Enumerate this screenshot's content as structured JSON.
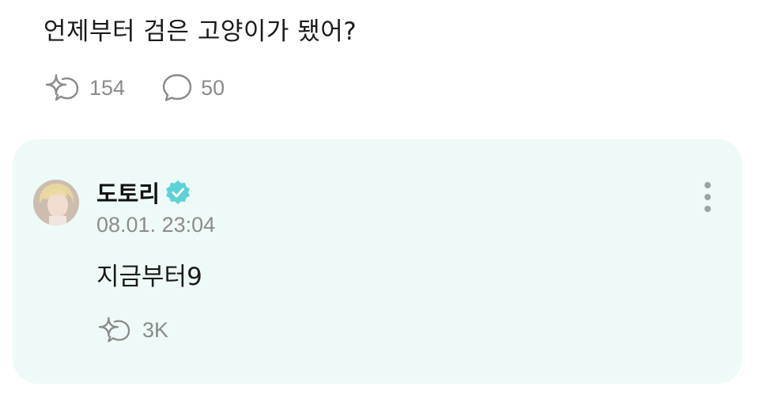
{
  "post": {
    "text": "언제부터 검은 고양이가 됐어?",
    "like_icon": "sparkle-like-icon",
    "like_count": "154",
    "comment_icon": "speech-bubble-icon",
    "comment_count": "50"
  },
  "comment": {
    "author": "도토리",
    "verified_icon": "verified-badge-icon",
    "timestamp": "08.01. 23:04",
    "text": "지금부터9",
    "like_icon": "sparkle-like-icon",
    "like_count": "3K",
    "more_icon": "kebab-menu-icon"
  },
  "colors": {
    "card_background": "#eefaf7",
    "verified_badge": "#5ed2d6",
    "secondary_text": "#8a8a8a",
    "primary_text": "#1a1a1a"
  }
}
